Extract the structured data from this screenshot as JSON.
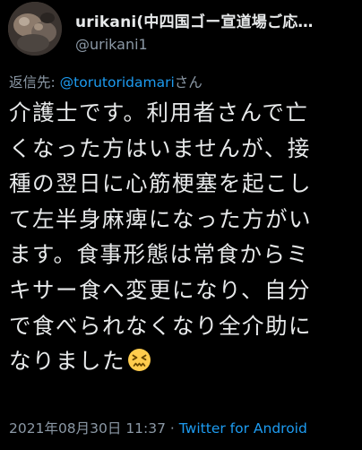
{
  "user": {
    "display_name": "urikani(中四国ゴー宣道場ご応…",
    "handle": "@urikani1"
  },
  "reply": {
    "prefix": "返信先: ",
    "mention": "@torutoridamari",
    "suffix": "さん"
  },
  "tweet": {
    "lines": [
      "介護士です。利用者さんで亡",
      "くなった方はいませんが、接",
      "種の翌日に心筋梗塞を起こし",
      "て左半身麻痺になった方がい",
      "ます。食事形態は常食からミ",
      "キサー食へ変更になり、自分",
      "で食べられなくなり全介助に",
      "なりました"
    ],
    "emoji": "confounded-face-emoji"
  },
  "meta": {
    "timestamp": "2021年08月30日 11:37",
    "separator": " · ",
    "source": "Twitter for Android"
  },
  "colors": {
    "background": "#000000",
    "text": "#e7e9ea",
    "secondary": "#8b98a5",
    "link": "#1d9bf0"
  }
}
